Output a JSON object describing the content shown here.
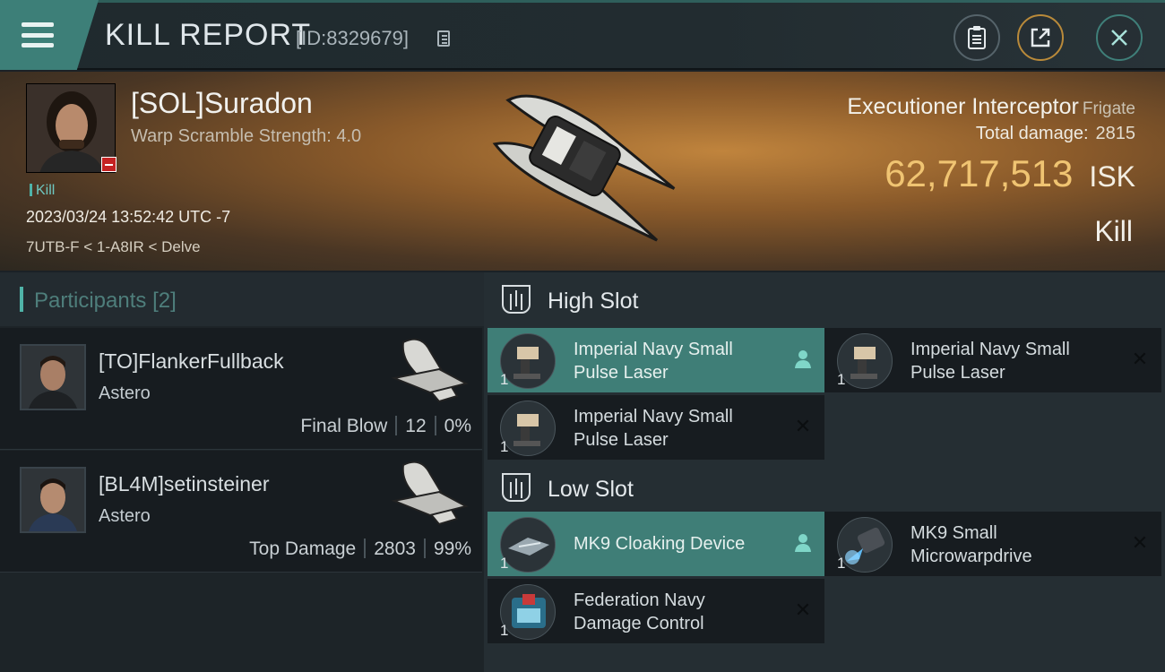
{
  "header": {
    "title": "KILL REPORT",
    "report_id": "[ID:8329679]"
  },
  "victim": {
    "name": "[SOL]Suradon",
    "warp_scramble": "Warp Scramble Strength: 4.0",
    "tag": "Kill",
    "datetime": "2023/03/24 13:52:42 UTC -7",
    "location": "7UTB-F < 1-A8IR < Delve",
    "ship_name": "Executioner Interceptor",
    "ship_class": "Frigate",
    "total_damage_label": "Total damage:",
    "total_damage": "2815",
    "isk_value": "62,717,513",
    "isk_unit": "ISK",
    "result": "Kill"
  },
  "participants": {
    "title": "Participants",
    "count": "[2]",
    "items": [
      {
        "name": "[TO]FlankerFullback",
        "ship": "Astero",
        "role": "Final Blow",
        "damage": "12",
        "percent": "0%"
      },
      {
        "name": "[BL4M]setinsteiner",
        "ship": "Astero",
        "role": "Top Damage",
        "damage": "2803",
        "percent": "99%"
      }
    ]
  },
  "fitting": {
    "high_slot_label": "High Slot",
    "low_slot_label": "Low Slot",
    "high": [
      {
        "qty": "1",
        "name_line1": "Imperial Navy Small",
        "name_line2": "Pulse Laser",
        "status": "dropped"
      },
      {
        "qty": "1",
        "name_line1": "Imperial Navy Small",
        "name_line2": "Pulse Laser",
        "status": "destroyed"
      },
      {
        "qty": "1",
        "name_line1": "Imperial Navy Small",
        "name_line2": "Pulse Laser",
        "status": "destroyed"
      }
    ],
    "low": [
      {
        "qty": "1",
        "name_line1": "MK9 Cloaking Device",
        "name_line2": "",
        "status": "dropped"
      },
      {
        "qty": "1",
        "name_line1": "MK9 Small",
        "name_line2": "Microwarpdrive",
        "status": "destroyed"
      },
      {
        "qty": "1",
        "name_line1": "Federation Navy",
        "name_line2": "Damage Control",
        "status": "destroyed"
      }
    ]
  },
  "colors": {
    "accent_teal": "#3f7e77",
    "isk_gold": "#f0c472",
    "loss_red": "#c42323"
  }
}
